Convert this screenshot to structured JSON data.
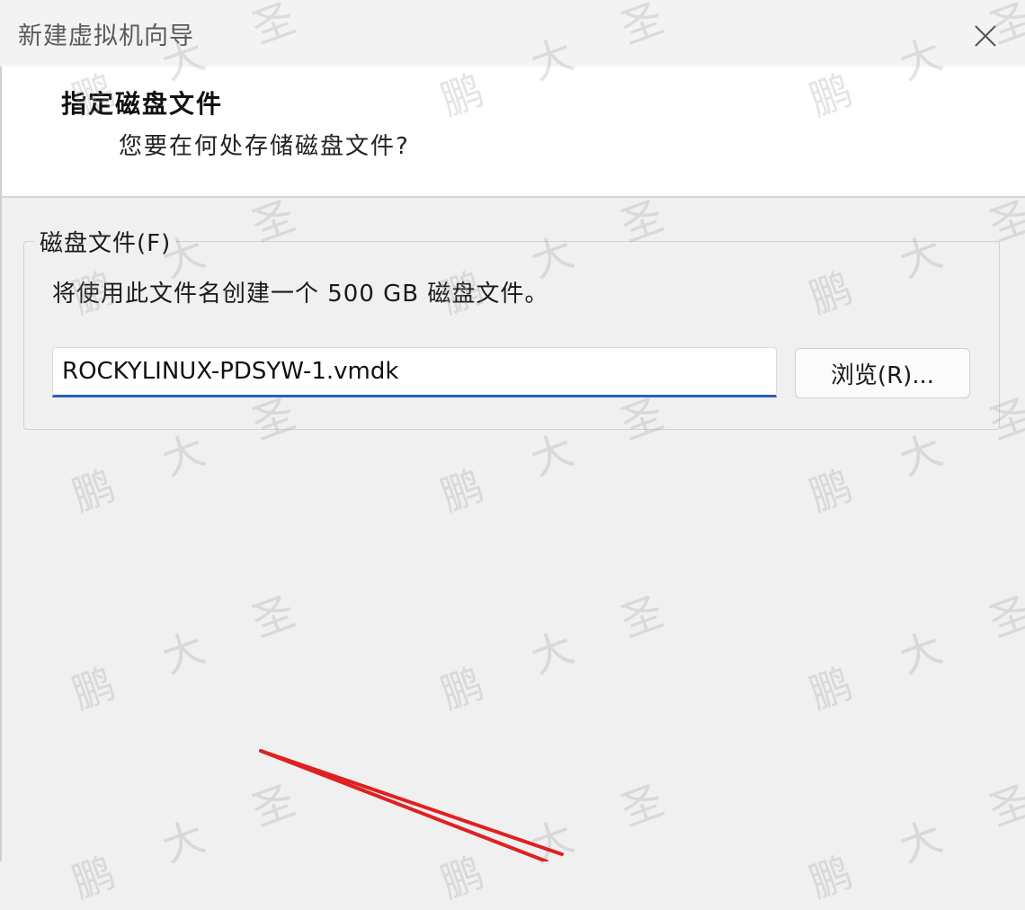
{
  "window": {
    "title": "新建虚拟机向导",
    "close_icon": "close-icon"
  },
  "header": {
    "title": "指定磁盘文件",
    "subtitle": "您要在何处存储磁盘文件?"
  },
  "disk_file_group": {
    "legend": "磁盘文件(F)",
    "description": "将使用此文件名创建一个 500 GB 磁盘文件。",
    "file_name_value": "ROCKYLINUX-PDSYW-1.vmdk",
    "browse_label": "浏览(R)..."
  },
  "watermark": {
    "chars": [
      "鹏",
      "大",
      "圣"
    ]
  },
  "colors": {
    "input_focus_underline": "#2a5dbf",
    "annotation_arrow": "#e02020"
  }
}
